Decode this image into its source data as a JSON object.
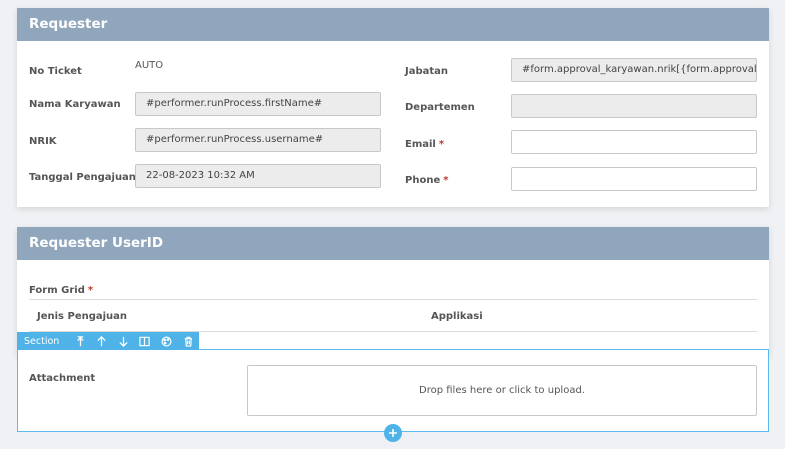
{
  "requester": {
    "title": "Requester",
    "no_ticket_label": "No Ticket",
    "no_ticket_value": "AUTO",
    "nama_label": "Nama Karyawan",
    "nama_value": "#performer.runProcess.firstName#",
    "nrik_label": "NRIK",
    "nrik_value": "#performer.runProcess.username#",
    "tanggal_label": "Tanggal Pengajuan",
    "tanggal_value": "22-08-2023 10:32 AM",
    "jabatan_label": "Jabatan",
    "jabatan_value": "#form.approval_karyawan.nrik[{form.approval_rec",
    "departemen_label": "Departemen",
    "departemen_value": "",
    "email_label": "Email",
    "email_value": "",
    "phone_label": "Phone",
    "phone_value": "",
    "required_mark": "*"
  },
  "requester_userid": {
    "title": "Requester UserID",
    "form_grid_label": "Form Grid",
    "columns": [
      "Jenis Pengajuan",
      "Applikasi"
    ]
  },
  "section_toolbar": {
    "label": "Section",
    "icons": [
      "move-icon",
      "arrow-up-icon",
      "arrow-down-icon",
      "columns-icon",
      "palette-icon",
      "trash-icon"
    ]
  },
  "attachment": {
    "label": "Attachment",
    "dropzone_text": "Drop files here or click to upload."
  },
  "colors": {
    "header_bg": "#8fa6bc",
    "accent": "#4fb3e8",
    "required": "#c0392b"
  }
}
